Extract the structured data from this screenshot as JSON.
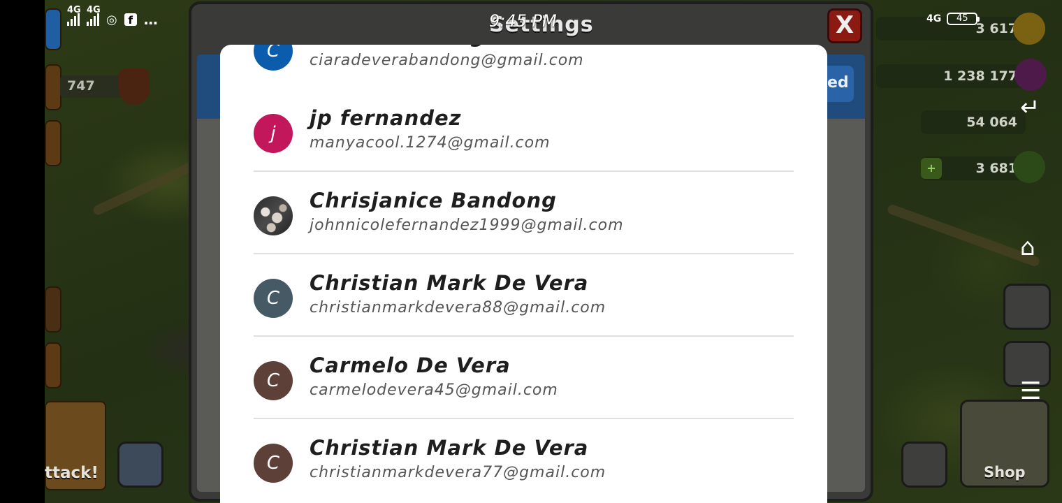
{
  "status_bar": {
    "time": "9:45 PM",
    "network_left_1": "4G",
    "network_left_2": "4G",
    "network_right": "4G",
    "battery": "45",
    "more": "…"
  },
  "background_game": {
    "settings_title": "Settings",
    "close_label": "X",
    "resource_1": "3 617",
    "resource_2": "1 238 177",
    "resource_3": "54 064",
    "resource_4": "3 681",
    "trophies": "747",
    "attack_label": "ttack!",
    "shop_label": "Shop",
    "right_tab_fragment": "ed"
  },
  "account_picker": {
    "accounts": [
      {
        "name": "Ciara Bandong",
        "email": "ciaradeverabandong@gmail.com",
        "initial": "C",
        "avatar_color": "#0b5cad"
      },
      {
        "name": "jp fernandez",
        "email": "manyacool.1274@gmail.com",
        "initial": "j",
        "avatar_color": "#c2185b"
      },
      {
        "name": "Chrisjanice Bandong",
        "email": "johnnicolefernandez1999@gmail.com",
        "initial": "",
        "avatar_color": "photo"
      },
      {
        "name": "Christian Mark De Vera",
        "email": "christianmarkdevera88@gmail.com",
        "initial": "C",
        "avatar_color": "#455a64"
      },
      {
        "name": "Carmelo De Vera",
        "email": "carmelodevera45@gmail.com",
        "initial": "C",
        "avatar_color": "#5d4037"
      },
      {
        "name": "Christian Mark De Vera",
        "email": "christianmarkdevera77@gmail.com",
        "initial": "C",
        "avatar_color": "#5d4037"
      }
    ]
  }
}
